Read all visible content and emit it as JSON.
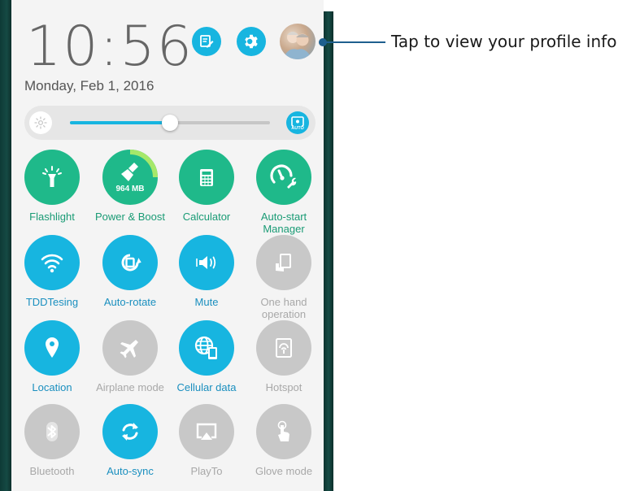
{
  "header": {
    "time": "10:56",
    "date": "Monday, Feb 1, 2016"
  },
  "header_buttons": [
    {
      "name": "edit-icon"
    },
    {
      "name": "settings-icon"
    },
    {
      "name": "profile-avatar"
    }
  ],
  "brightness": {
    "level": 0.5,
    "auto_label": "AUTO"
  },
  "callout": {
    "text": "Tap to view your profile info"
  },
  "tiles": [
    {
      "label": "Flashlight",
      "icon": "flashlight-icon",
      "state": "green"
    },
    {
      "label": "Power & Boost",
      "icon": "broom-icon",
      "state": "green",
      "badge": "964 MB"
    },
    {
      "label": "Calculator",
      "icon": "calculator-icon",
      "state": "green"
    },
    {
      "label": "Auto-start Manager",
      "icon": "gauge-wrench-icon",
      "state": "green"
    },
    {
      "label": "TDDTesing",
      "icon": "wifi-icon",
      "state": "blue"
    },
    {
      "label": "Auto-rotate",
      "icon": "rotate-icon",
      "state": "blue"
    },
    {
      "label": "Mute",
      "icon": "vibrate-icon",
      "state": "blue"
    },
    {
      "label": "One hand operation",
      "icon": "one-hand-icon",
      "state": "gray"
    },
    {
      "label": "Location",
      "icon": "location-icon",
      "state": "blue"
    },
    {
      "label": "Airplane mode",
      "icon": "airplane-icon",
      "state": "gray"
    },
    {
      "label": "Cellular data",
      "icon": "globe-phone-icon",
      "state": "blue"
    },
    {
      "label": "Hotspot",
      "icon": "hotspot-icon",
      "state": "gray"
    },
    {
      "label": "Bluetooth",
      "icon": "bluetooth-icon",
      "state": "gray"
    },
    {
      "label": "Auto-sync",
      "icon": "sync-icon",
      "state": "blue"
    },
    {
      "label": "PlayTo",
      "icon": "playto-icon",
      "state": "gray"
    },
    {
      "label": "Glove mode",
      "icon": "glove-touch-icon",
      "state": "gray"
    }
  ],
  "colors": {
    "green": "#1fb98a",
    "blue": "#17b5e0",
    "gray": "#c8c8c8",
    "callout": "#1e5f8e"
  }
}
